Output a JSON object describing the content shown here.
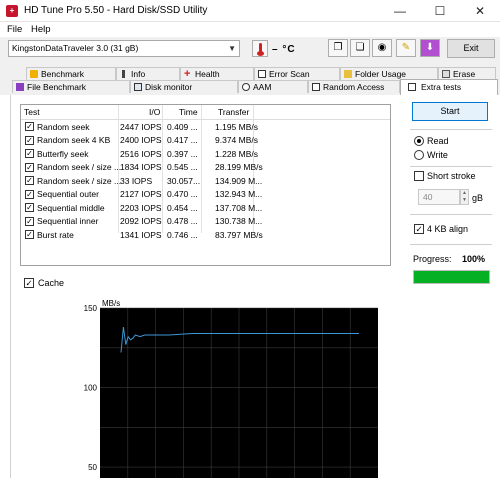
{
  "window": {
    "title": "HD Tune Pro 5.50 - Hard Disk/SSD Utility"
  },
  "menu": {
    "file": "File",
    "help": "Help"
  },
  "toolbar": {
    "drive": "KingstonDataTraveler 3.0 (31 gB)",
    "temperature": "– °C",
    "exit_label": "Exit"
  },
  "tabs_row1": [
    "Benchmark",
    "Info",
    "Health",
    "Error Scan",
    "Folder Usage",
    "Erase"
  ],
  "tabs_row2": [
    "File Benchmark",
    "Disk monitor",
    "AAM",
    "Random Access",
    "Extra tests"
  ],
  "table": {
    "headers": [
      "Test",
      "I/O",
      "Time",
      "Transfer"
    ],
    "rows": [
      {
        "test": "Random seek",
        "io": "2447 IOPS",
        "time": "0.409 ...",
        "transfer": "1.195 MB/s"
      },
      {
        "test": "Random seek 4 KB",
        "io": "2400 IOPS",
        "time": "0.417 ...",
        "transfer": "9.374 MB/s"
      },
      {
        "test": "Butterfly seek",
        "io": "2516 IOPS",
        "time": "0.397 ...",
        "transfer": "1.228 MB/s"
      },
      {
        "test": "Random seek / size ...",
        "io": "1834 IOPS",
        "time": "0.545 ...",
        "transfer": "28.199 MB/s"
      },
      {
        "test": "Random seek / size ...",
        "io": "33 IOPS",
        "time": "30.057...",
        "transfer": "134.909 M..."
      },
      {
        "test": "Sequential outer",
        "io": "2127 IOPS",
        "time": "0.470 ...",
        "transfer": "132.943 M..."
      },
      {
        "test": "Sequential middle",
        "io": "2203 IOPS",
        "time": "0.454 ...",
        "transfer": "137.708 M..."
      },
      {
        "test": "Sequential inner",
        "io": "2092 IOPS",
        "time": "0.478 ...",
        "transfer": "130.738 M..."
      },
      {
        "test": "Burst rate",
        "io": "1341 IOPS",
        "time": "0.746 ...",
        "transfer": "83.797 MB/s"
      }
    ]
  },
  "cache": {
    "label": "Cache",
    "checked": true
  },
  "right_panel": {
    "start_label": "Start",
    "read_label": "Read",
    "write_label": "Write",
    "mode": "read",
    "short_stroke_label": "Short stroke",
    "short_stroke_checked": false,
    "size_value": "40",
    "size_unit": "gB",
    "align_label": "4 KB align",
    "align_checked": true,
    "progress_label": "Progress:",
    "progress_text": "100%",
    "progress_fraction": 1.0
  },
  "colors": {
    "progress": "#06b025",
    "chart_line": "#3b97d3",
    "chart_bg": "#000000"
  },
  "chart_data": {
    "type": "line",
    "ylabel": "MB/s",
    "ytick_labels": [
      "150",
      "100",
      "50"
    ],
    "yticks": [
      150,
      100,
      50
    ],
    "ylim": [
      40,
      150
    ],
    "grid": true,
    "series": [
      {
        "x": [
          0,
          1,
          2,
          3,
          4,
          5,
          6,
          8,
          10,
          14,
          20,
          30,
          50,
          70,
          90,
          100
        ],
        "values": [
          122,
          138,
          127,
          132,
          130,
          131,
          133,
          132,
          133,
          133,
          133,
          134,
          134,
          134,
          134,
          134
        ]
      }
    ]
  }
}
